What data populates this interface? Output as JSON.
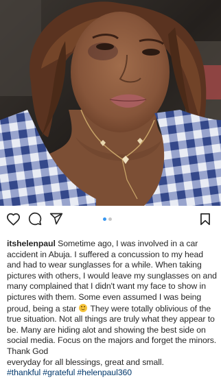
{
  "post": {
    "photo": {
      "alt": "",
      "colors": {
        "background": "#2b2723",
        "skin": "#8a5a3f",
        "hair": "#5a3320",
        "dress_blue": "#3a4e8f",
        "dress_white": "#e9ecf4"
      }
    },
    "actions": {
      "like_icon": "heart-icon",
      "comment_icon": "comment-icon",
      "share_icon": "share-icon",
      "save_icon": "bookmark-icon",
      "carousel_dots": {
        "count": 2,
        "active_index": 0,
        "active_color": "#3897f0",
        "inactive_color": "#c7c7c7"
      }
    },
    "caption": {
      "username": "itshelenpaul",
      "text_before_emoji": "Sometime ago, I was involved in a car accident in Abuja. I suffered a concussion to my head and had to wear sunglasses for a while. When taking pictures with others, I would leave my sunglasses on and many complained that I didn't want my face to show in pictures with them. Some even assumed I was being proud, being a star",
      "emoji": "grinning-face-emoji",
      "text_after_emoji": "They were totally oblivious of the true situation. Not all things are truly what they appear to be. Many are hiding alot and showing the best side on social media. Focus on the majors and forget the minors. Thank God",
      "last_line": "everyday for all blessings, great and small.",
      "hashtags": [
        "#thankful",
        "#grateful",
        "#helenpaul360"
      ],
      "hashtag_color": "#00376b"
    }
  }
}
